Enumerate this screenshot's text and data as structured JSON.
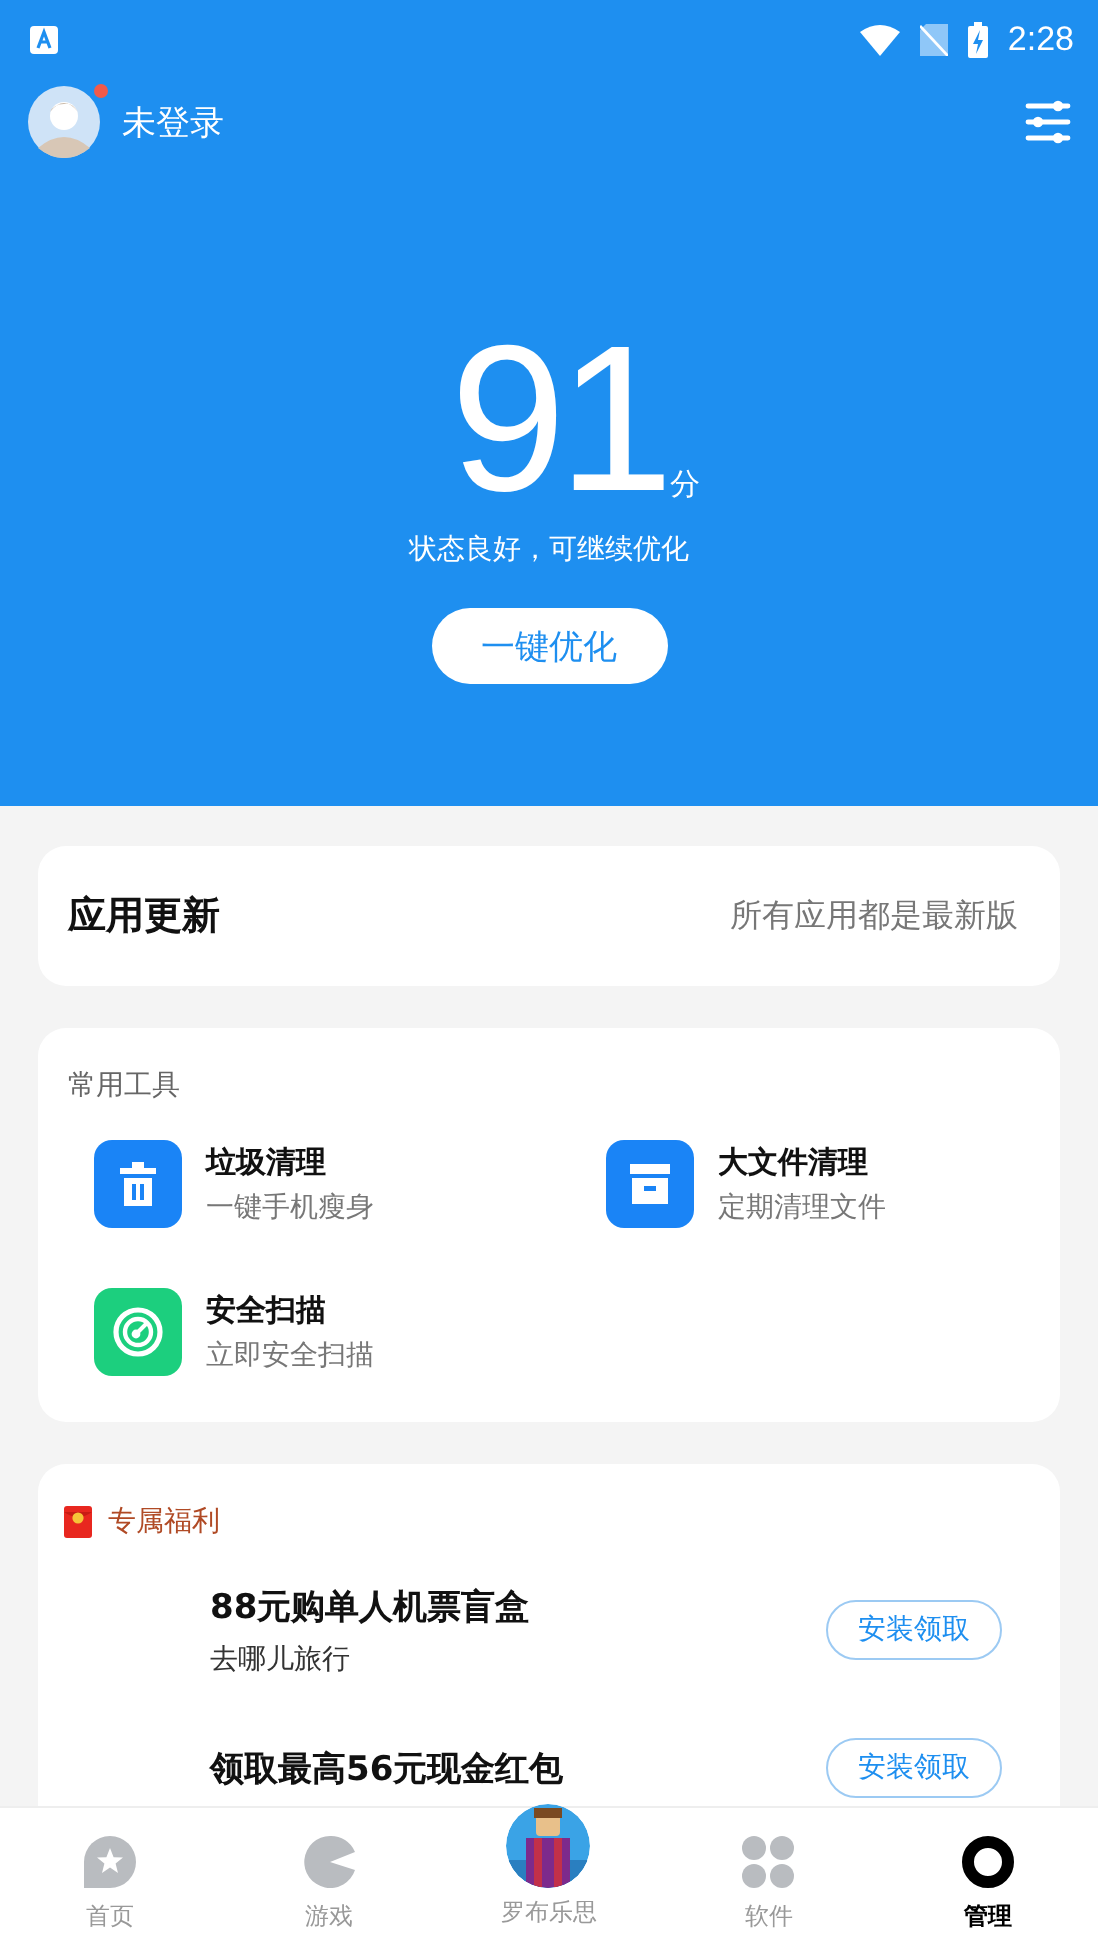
{
  "status_bar": {
    "time": "2:28"
  },
  "header": {
    "user_label": "未登录",
    "has_notification": true
  },
  "score": {
    "value": "91",
    "unit": "分",
    "status": "状态良好，可继续优化",
    "button": "一键优化"
  },
  "update_card": {
    "title": "应用更新",
    "status": "所有应用都是最新版"
  },
  "tools": {
    "title": "常用工具",
    "items": [
      {
        "kind": "trash",
        "name": "垃圾清理",
        "desc": "一键手机瘦身"
      },
      {
        "kind": "archive",
        "name": "大文件清理",
        "desc": "定期清理文件"
      },
      {
        "kind": "scan",
        "name": "安全扫描",
        "desc": "立即安全扫描"
      }
    ]
  },
  "benefits": {
    "title": "专属福利",
    "offers": [
      {
        "title": "88元购单人机票盲盒",
        "subtitle": "去哪儿旅行",
        "button": "安装领取"
      },
      {
        "title": "领取最高56元现金红包",
        "button": "安装领取"
      }
    ]
  },
  "bottom_nav": [
    {
      "kind": "home",
      "label": "首页",
      "selected": false
    },
    {
      "kind": "game",
      "label": "游戏",
      "selected": false
    },
    {
      "kind": "featured",
      "label": "罗布乐思",
      "selected": false
    },
    {
      "kind": "apps",
      "label": "软件",
      "selected": false
    },
    {
      "kind": "manage",
      "label": "管理",
      "selected": true
    }
  ]
}
